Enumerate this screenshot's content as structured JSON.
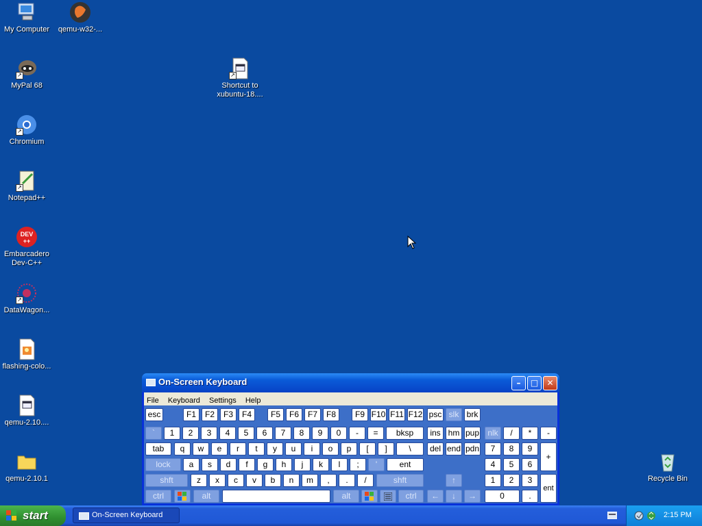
{
  "desktop": {
    "icons": [
      {
        "label": "My Computer"
      },
      {
        "label": "qemu-w32-..."
      },
      {
        "label": "MyPal 68"
      },
      {
        "label": "Shortcut to xubuntu-18...."
      },
      {
        "label": "Chromium"
      },
      {
        "label": "Notepad++"
      },
      {
        "label": "Embarcadero Dev-C++"
      },
      {
        "label": "DataWagon..."
      },
      {
        "label": "flashing-colo..."
      },
      {
        "label": "qemu-2.10...."
      },
      {
        "label": "qemu-2.10.1"
      },
      {
        "label": "Recycle Bin"
      }
    ]
  },
  "osk": {
    "title": "On-Screen Keyboard",
    "menu": [
      "File",
      "Keyboard",
      "Settings",
      "Help"
    ],
    "rows": {
      "r0": [
        "esc",
        "F1",
        "F2",
        "F3",
        "F4",
        "F5",
        "F6",
        "F7",
        "F8",
        "F9",
        "F10",
        "F11",
        "F12",
        "psc",
        "slk",
        "brk"
      ],
      "r1": [
        "`",
        "1",
        "2",
        "3",
        "4",
        "5",
        "6",
        "7",
        "8",
        "9",
        "0",
        "-",
        "=",
        "bksp",
        "ins",
        "hm",
        "pup",
        "nlk",
        "/",
        "*",
        "-"
      ],
      "r2": [
        "tab",
        "q",
        "w",
        "e",
        "r",
        "t",
        "y",
        "u",
        "i",
        "o",
        "p",
        "[",
        "]",
        "\\",
        "del",
        "end",
        "pdn",
        "7",
        "8",
        "9",
        "+"
      ],
      "r3": [
        "lock",
        "a",
        "s",
        "d",
        "f",
        "g",
        "h",
        "j",
        "k",
        "l",
        ";",
        "'",
        "ent",
        "4",
        "5",
        "6"
      ],
      "r4": [
        "shft",
        "z",
        "x",
        "c",
        "v",
        "b",
        "n",
        "m",
        ",",
        ".",
        "/",
        "shft",
        "↑",
        "1",
        "2",
        "3",
        "ent"
      ],
      "r5": [
        "ctrl",
        "alt",
        "alt",
        "ctrl",
        "←",
        "↓",
        "→",
        "0",
        "."
      ]
    }
  },
  "taskbar": {
    "start_label": "start",
    "task_label": "On-Screen Keyboard",
    "clock": "2:15 PM"
  }
}
